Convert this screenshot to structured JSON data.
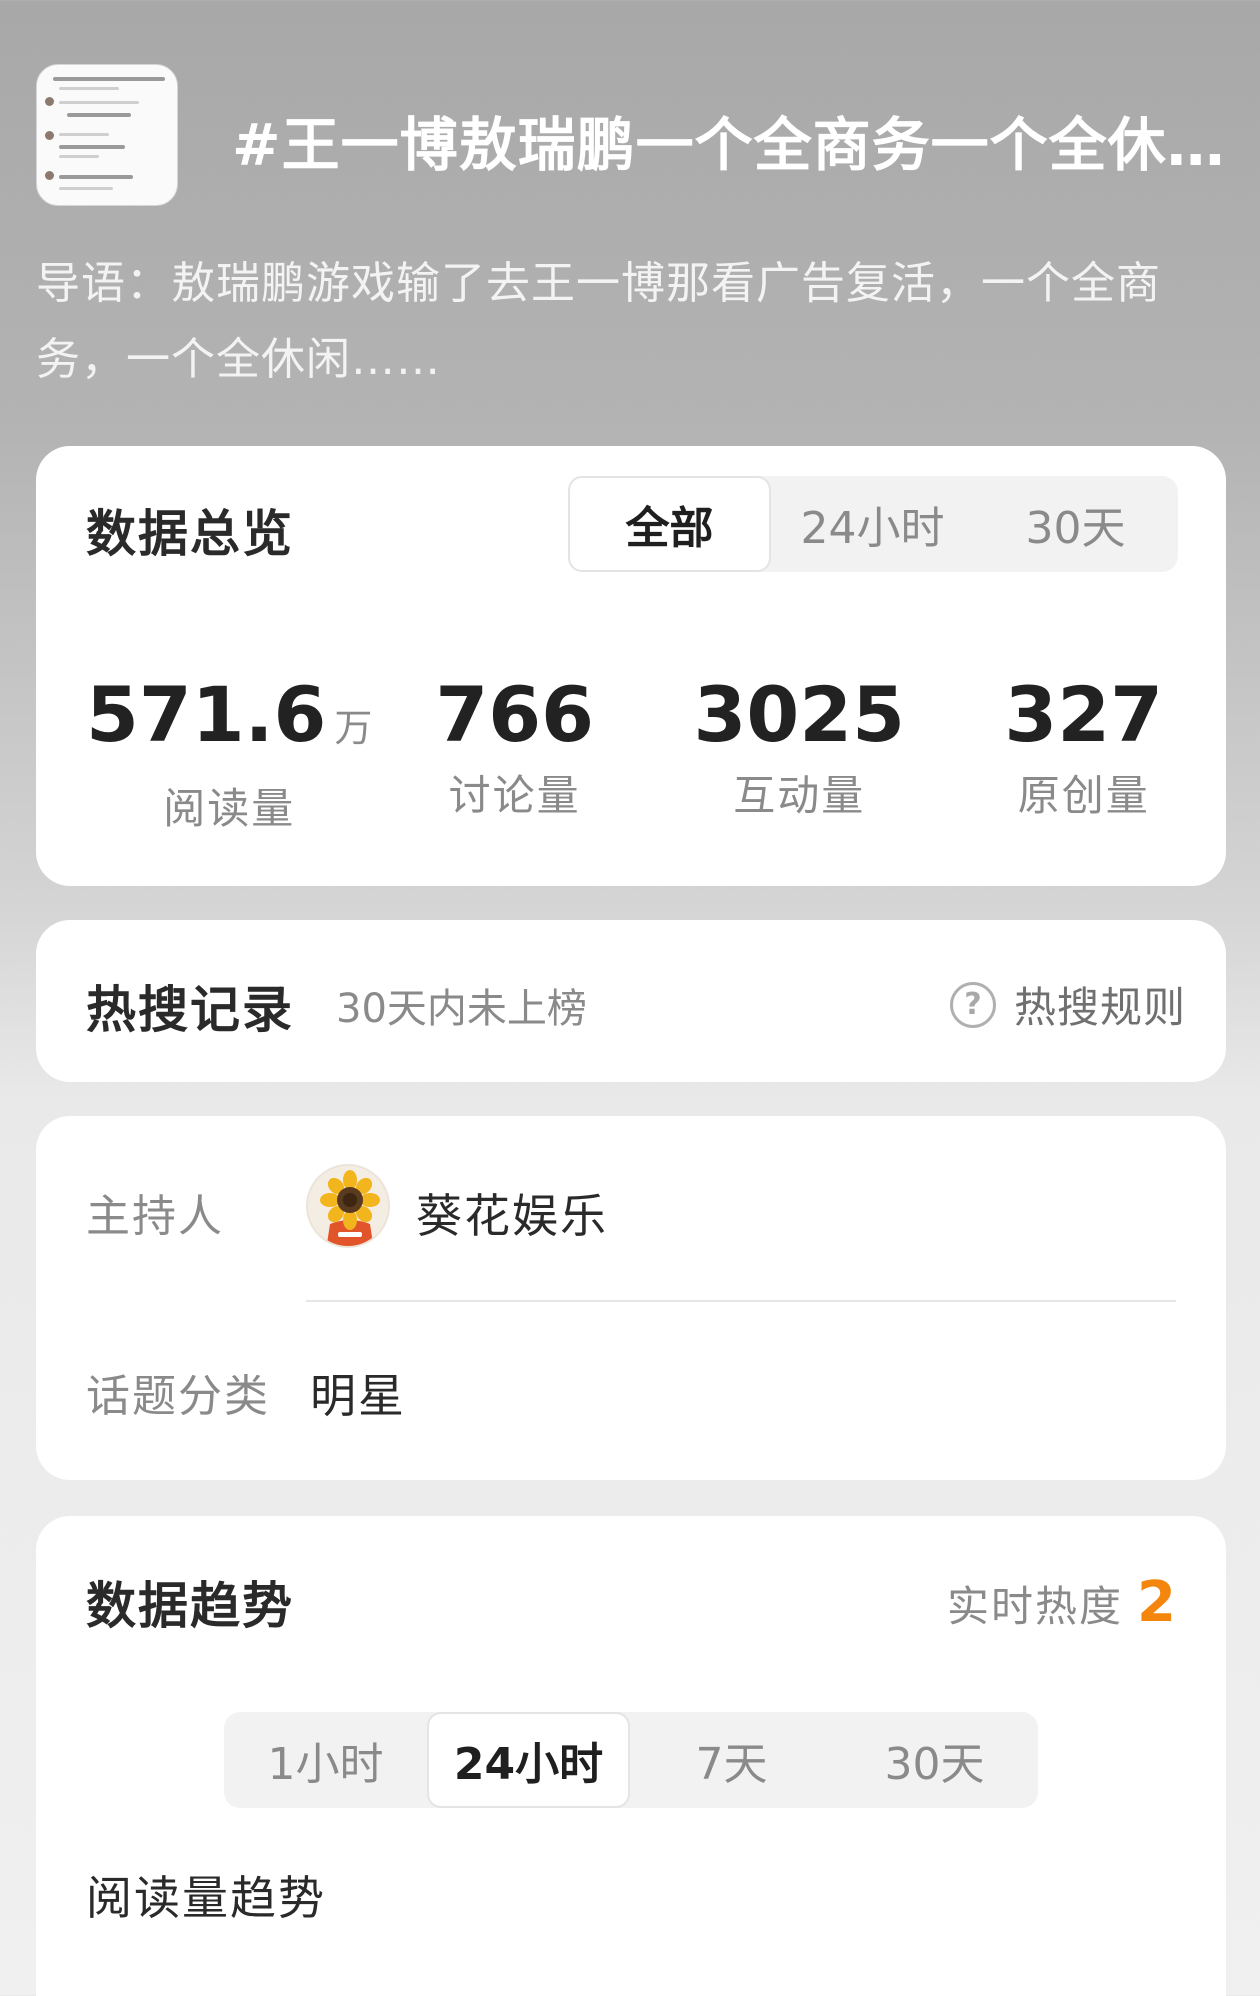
{
  "header": {
    "title": "#王一博敖瑞鹏一个全商务一个全休闲#",
    "intro": "导语：敖瑞鹏游戏输了去王一博那看广告复活，一个全商务，一个全休闲……"
  },
  "overview": {
    "title": "数据总览",
    "tabs": [
      "全部",
      "24小时",
      "30天"
    ],
    "active_tab": "全部",
    "stats": [
      {
        "value": "571.6",
        "unit": "万",
        "label": "阅读量"
      },
      {
        "value": "766",
        "unit": "",
        "label": "讨论量"
      },
      {
        "value": "3025",
        "unit": "",
        "label": "互动量"
      },
      {
        "value": "327",
        "unit": "",
        "label": "原创量"
      }
    ]
  },
  "hot_search": {
    "title": "热搜记录",
    "subtitle": "30天内未上榜",
    "rule_label": "热搜规则",
    "rule_icon": "question-circle-icon"
  },
  "host": {
    "host_label": "主持人",
    "host_name": "葵花娱乐",
    "category_label": "话题分类",
    "category_value": "明星"
  },
  "trend": {
    "title": "数据趋势",
    "realtime_label": "实时热度",
    "realtime_value": "2",
    "tabs": [
      "1小时",
      "24小时",
      "7天",
      "30天"
    ],
    "active_tab": "24小时",
    "section_title": "阅读量趋势"
  },
  "colors": {
    "accent_orange": "#f5860d",
    "muted_text": "#8a8a8a",
    "card_bg": "#ffffff"
  }
}
